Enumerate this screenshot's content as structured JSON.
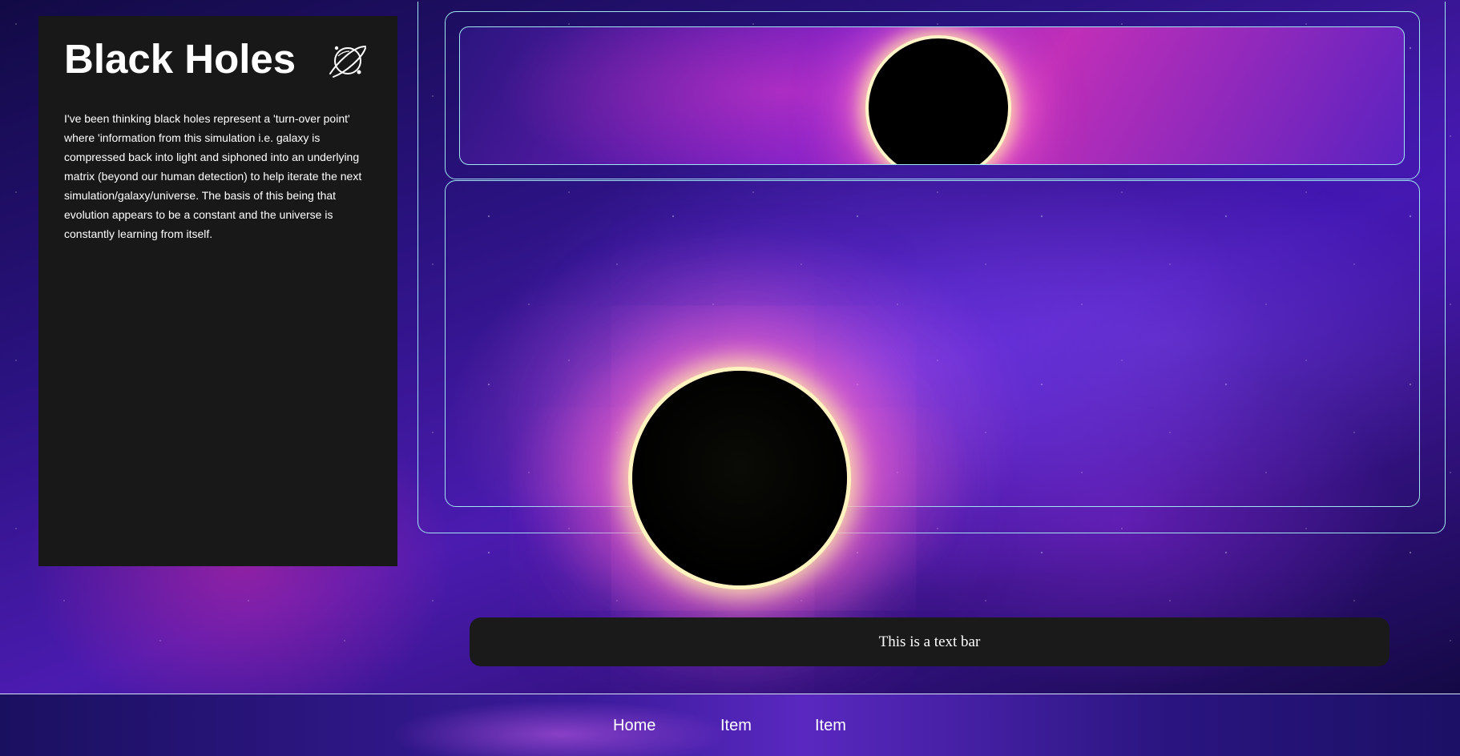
{
  "sidebar": {
    "title": "Black Holes",
    "icon": "planet-icon",
    "body": "I've been thinking black holes represent a 'turn-over point' where 'information from this simulation i.e. galaxy is compressed back into light and siphoned into an underlying matrix (beyond our human detection) to help iterate the next simulation/galaxy/universe. The basis of this being that evolution appears to be a constant and the universe is constantly learning from itself."
  },
  "text_bar": {
    "value": "This is a text bar"
  },
  "nav": {
    "items": [
      {
        "label": "Home"
      },
      {
        "label": "Item"
      },
      {
        "label": "Item"
      }
    ]
  },
  "colors": {
    "panel": "#181818",
    "frame_border": "#9fe6f0",
    "text": "#ffffff"
  }
}
